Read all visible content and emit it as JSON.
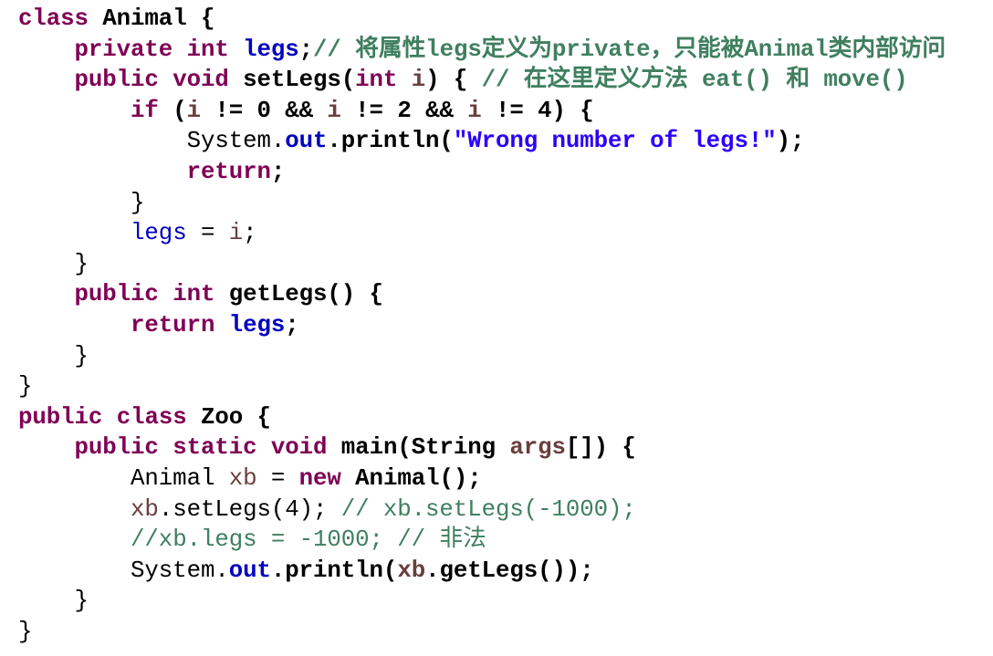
{
  "colors": {
    "plain": "#000000",
    "keyword": "#7f0055",
    "field": "#0000c0",
    "string": "#2a00ff",
    "comment": "#3f7f5f",
    "var": "#6a3e3e"
  },
  "lines": [
    {
      "tokens": [
        {
          "t": "class",
          "k": "keyword",
          "b": 1
        },
        {
          "t": " Animal {",
          "k": "plain",
          "b": 1
        }
      ]
    },
    {
      "tokens": [
        {
          "t": "    private",
          "k": "keyword",
          "b": 1
        },
        {
          "t": " ",
          "k": "plain",
          "b": 1
        },
        {
          "t": "int",
          "k": "keyword",
          "b": 1
        },
        {
          "t": " ",
          "k": "plain",
          "b": 1
        },
        {
          "t": "legs",
          "k": "field",
          "b": 1
        },
        {
          "t": ";",
          "k": "plain",
          "b": 1
        },
        {
          "t": "// 将属性legs定义为private，只能被Animal类内部访问",
          "k": "comment",
          "b": 1
        }
      ]
    },
    {
      "tokens": [
        {
          "t": "    public",
          "k": "keyword",
          "b": 1
        },
        {
          "t": " ",
          "k": "plain",
          "b": 1
        },
        {
          "t": "void",
          "k": "keyword",
          "b": 1
        },
        {
          "t": " setLegs(",
          "k": "plain",
          "b": 1
        },
        {
          "t": "int",
          "k": "keyword",
          "b": 1
        },
        {
          "t": " ",
          "k": "plain",
          "b": 1
        },
        {
          "t": "i",
          "k": "var",
          "b": 1
        },
        {
          "t": ") { ",
          "k": "plain",
          "b": 1
        },
        {
          "t": "// 在这里定义方法 eat() 和 move()",
          "k": "comment",
          "b": 1
        }
      ]
    },
    {
      "tokens": [
        {
          "t": "        if",
          "k": "keyword",
          "b": 1
        },
        {
          "t": " (",
          "k": "plain",
          "b": 1
        },
        {
          "t": "i",
          "k": "var",
          "b": 1
        },
        {
          "t": " != 0 && ",
          "k": "plain",
          "b": 1
        },
        {
          "t": "i",
          "k": "var",
          "b": 1
        },
        {
          "t": " != 2 && ",
          "k": "plain",
          "b": 1
        },
        {
          "t": "i",
          "k": "var",
          "b": 1
        },
        {
          "t": " != 4) {",
          "k": "plain",
          "b": 1
        }
      ]
    },
    {
      "tokens": [
        {
          "t": "            System.",
          "k": "plain",
          "b": 0
        },
        {
          "t": "out",
          "k": "field",
          "b": 1
        },
        {
          "t": ".println(",
          "k": "plain",
          "b": 1
        },
        {
          "t": "\"Wrong number of legs!\"",
          "k": "string",
          "b": 1
        },
        {
          "t": ");",
          "k": "plain",
          "b": 1
        }
      ]
    },
    {
      "tokens": [
        {
          "t": "            return",
          "k": "keyword",
          "b": 1
        },
        {
          "t": ";",
          "k": "plain",
          "b": 1
        }
      ]
    },
    {
      "tokens": [
        {
          "t": "        }",
          "k": "plain",
          "b": 0
        }
      ]
    },
    {
      "tokens": [
        {
          "t": "        ",
          "k": "plain",
          "b": 0
        },
        {
          "t": "legs",
          "k": "field",
          "b": 0
        },
        {
          "t": " = ",
          "k": "plain",
          "b": 0
        },
        {
          "t": "i",
          "k": "var",
          "b": 0
        },
        {
          "t": ";",
          "k": "plain",
          "b": 0
        }
      ]
    },
    {
      "tokens": [
        {
          "t": "    }",
          "k": "plain",
          "b": 0
        }
      ]
    },
    {
      "tokens": [
        {
          "t": "    public",
          "k": "keyword",
          "b": 1
        },
        {
          "t": " ",
          "k": "plain",
          "b": 1
        },
        {
          "t": "int",
          "k": "keyword",
          "b": 1
        },
        {
          "t": " getLegs() {",
          "k": "plain",
          "b": 1
        }
      ]
    },
    {
      "tokens": [
        {
          "t": "        return",
          "k": "keyword",
          "b": 1
        },
        {
          "t": " ",
          "k": "plain",
          "b": 1
        },
        {
          "t": "legs",
          "k": "field",
          "b": 1
        },
        {
          "t": ";",
          "k": "plain",
          "b": 1
        }
      ]
    },
    {
      "tokens": [
        {
          "t": "    }",
          "k": "plain",
          "b": 0
        }
      ]
    },
    {
      "tokens": [
        {
          "t": "}",
          "k": "plain",
          "b": 0
        }
      ]
    },
    {
      "tokens": [
        {
          "t": "public",
          "k": "keyword",
          "b": 1
        },
        {
          "t": " ",
          "k": "plain",
          "b": 1
        },
        {
          "t": "class",
          "k": "keyword",
          "b": 1
        },
        {
          "t": " Zoo {",
          "k": "plain",
          "b": 1
        }
      ]
    },
    {
      "tokens": [
        {
          "t": "    public",
          "k": "keyword",
          "b": 1
        },
        {
          "t": " ",
          "k": "plain",
          "b": 1
        },
        {
          "t": "static",
          "k": "keyword",
          "b": 1
        },
        {
          "t": " ",
          "k": "plain",
          "b": 1
        },
        {
          "t": "void",
          "k": "keyword",
          "b": 1
        },
        {
          "t": " main(String ",
          "k": "plain",
          "b": 1
        },
        {
          "t": "args",
          "k": "var",
          "b": 1
        },
        {
          "t": "[]) {",
          "k": "plain",
          "b": 1
        }
      ]
    },
    {
      "tokens": [
        {
          "t": "        Animal ",
          "k": "plain",
          "b": 0
        },
        {
          "t": "xb",
          "k": "var",
          "b": 0
        },
        {
          "t": " = ",
          "k": "plain",
          "b": 0
        },
        {
          "t": "new",
          "k": "keyword",
          "b": 1
        },
        {
          "t": " Animal();",
          "k": "plain",
          "b": 1
        }
      ]
    },
    {
      "tokens": [
        {
          "t": "        ",
          "k": "plain",
          "b": 0
        },
        {
          "t": "xb",
          "k": "var",
          "b": 0
        },
        {
          "t": ".setLegs(4); ",
          "k": "plain",
          "b": 0
        },
        {
          "t": "// xb.setLegs(-1000);",
          "k": "comment",
          "b": 0
        }
      ]
    },
    {
      "tokens": [
        {
          "t": "        ",
          "k": "plain",
          "b": 0
        },
        {
          "t": "//xb.legs = -1000; // 非法",
          "k": "comment",
          "b": 0
        }
      ]
    },
    {
      "tokens": [
        {
          "t": "        System.",
          "k": "plain",
          "b": 0
        },
        {
          "t": "out",
          "k": "field",
          "b": 1
        },
        {
          "t": ".println(",
          "k": "plain",
          "b": 1
        },
        {
          "t": "xb",
          "k": "var",
          "b": 1
        },
        {
          "t": ".getLegs());",
          "k": "plain",
          "b": 1
        }
      ]
    },
    {
      "tokens": [
        {
          "t": "    }",
          "k": "plain",
          "b": 0
        }
      ]
    },
    {
      "tokens": [
        {
          "t": "}",
          "k": "plain",
          "b": 0
        }
      ]
    }
  ]
}
